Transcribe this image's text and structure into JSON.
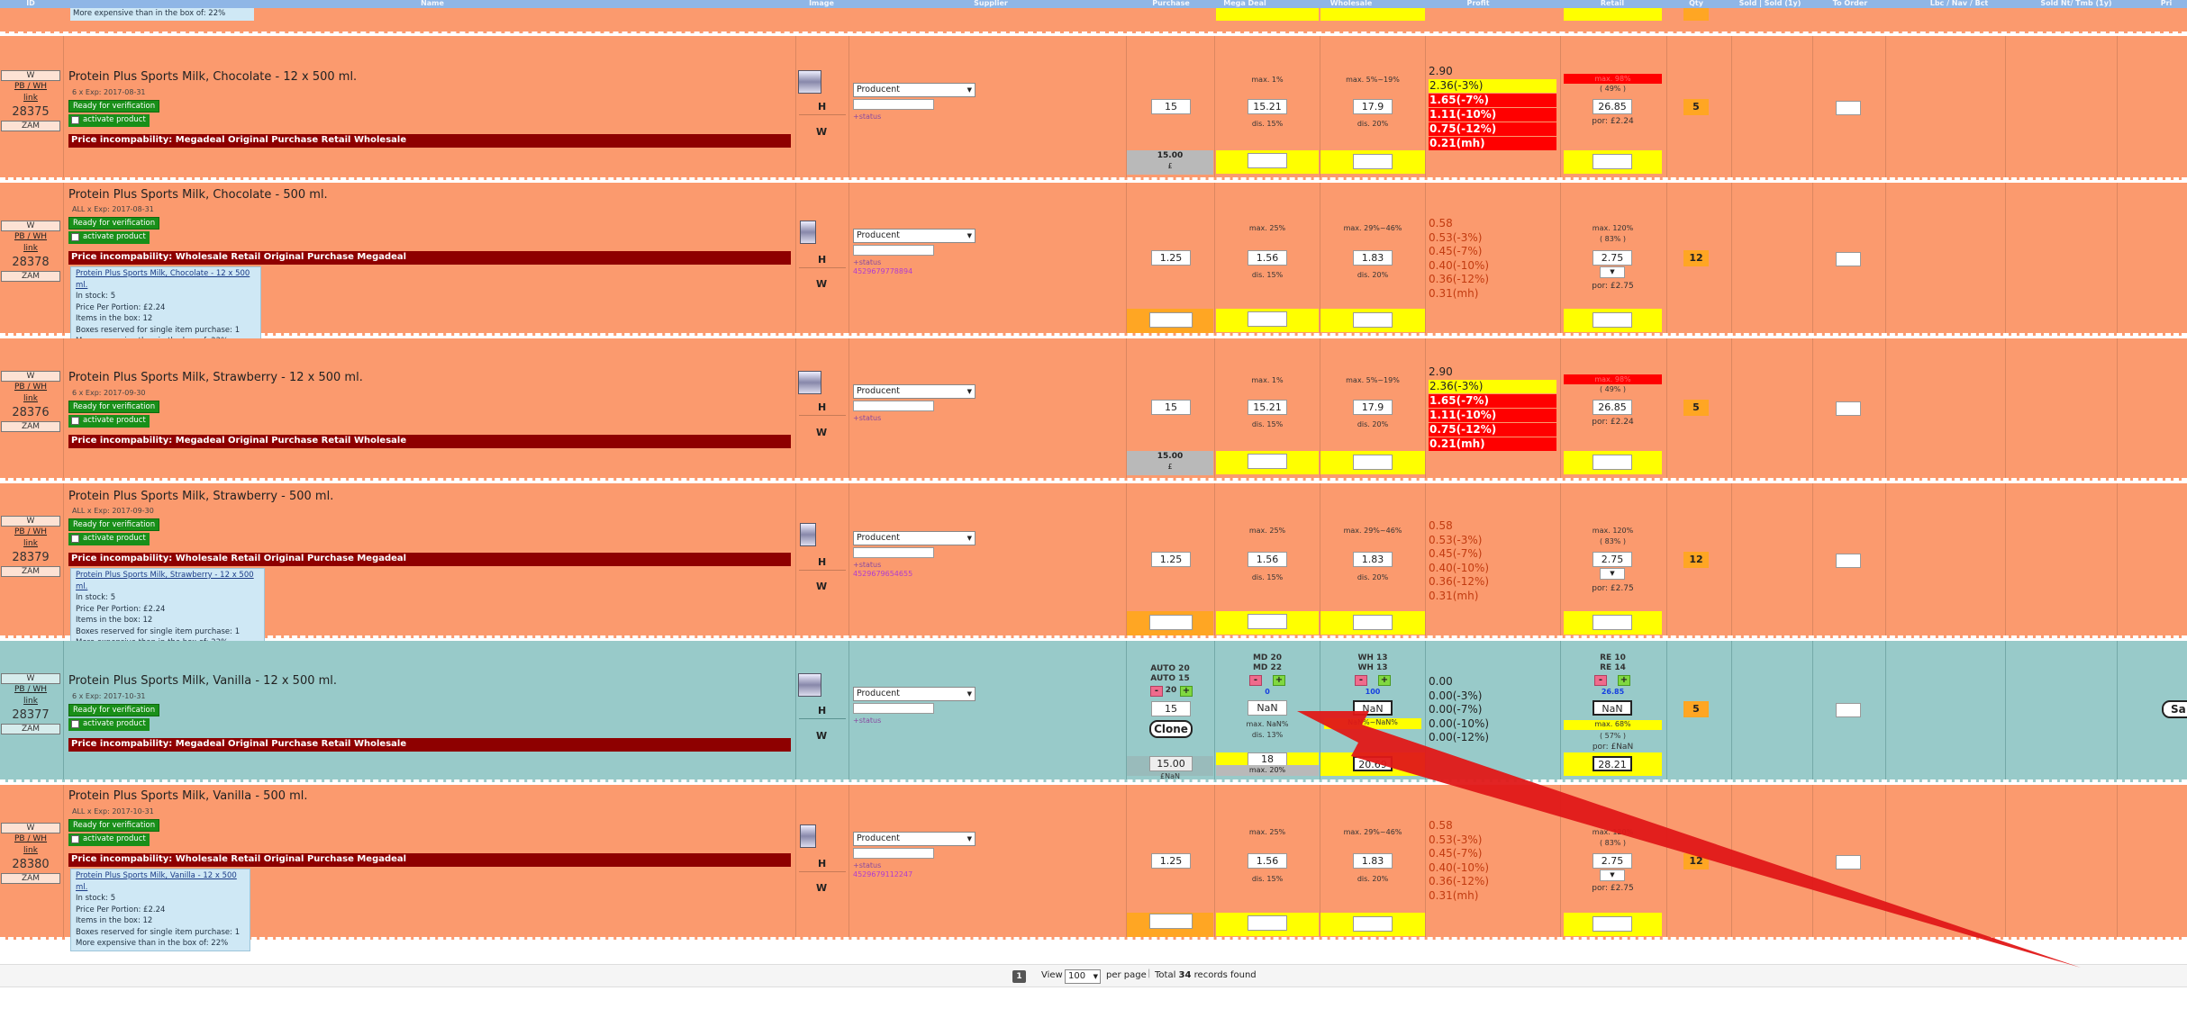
{
  "headers": [
    "ID",
    "Name",
    "Image",
    "Supplier",
    "Purchase",
    "Mega Deal",
    "Wholesale",
    "Profit",
    "Retail",
    "Qty",
    "Sold | Sold (1y)",
    "To Order",
    "Lbc / Nav / Bct",
    "Sold Nt/ Tmb (1y)",
    "Pri"
  ],
  "top_strip_text": "More expensive than in the box of: 22%",
  "common": {
    "w": "W",
    "pb": "PB",
    "wh": "WH",
    "slash": "/",
    "link": "link",
    "zam": "ZAM",
    "h_label": "H",
    "w_label": "W",
    "ready": "Ready for verification",
    "activate": "activate product",
    "supplier": "Producent",
    "status": "+status",
    "in_stock": "In stock: 5",
    "price_portion": "Price Per Portion: £2.24",
    "items_box": "Items in the box: 12",
    "boxes_reserved": "Boxes reserved for single item purchase: 1",
    "more_expensive": "More expensive than in the box of: 22%"
  },
  "rows": [
    {
      "id": "28375",
      "name": "Protein Plus Sports Milk, Chocolate - 12 x 500 ml.",
      "exp": "6 x Exp: 2017-08-31",
      "incompat": "Price incompability: Megadeal Original Purchase Retail Wholesale",
      "purchase": "15",
      "purchase_foot": "15.00",
      "purchase_foot2": "£",
      "mega_top": "max. 1%",
      "mega": "15.21",
      "mega_bottom": "dis. 15%",
      "wh_top": "max. 5%~19%",
      "wholesale": "17.9",
      "wh_bottom": "dis. 20%",
      "profit": [
        "2.90",
        "2.36(-3%)",
        "1.65(-7%)",
        "1.11(-10%)",
        "0.75(-12%)",
        "0.21(mh)"
      ],
      "retail_top": "max. 98%",
      "retail_pct": "( 49% )",
      "retail": "26.85",
      "retail_por": "por: £2.24",
      "qty": "5"
    },
    {
      "id": "28378",
      "name": "Protein Plus Sports Milk, Chocolate - 500 ml.",
      "exp": "ALL x Exp: 2017-08-31",
      "incompat": "Price incompability: Wholesale Retail Original Purchase Megadeal",
      "box_link": "Protein Plus Sports Milk, Chocolate - 12 x 500 ml.",
      "ean": "4529679778894",
      "purchase": "1.25",
      "mega_top": "max. 25%",
      "mega": "1.56",
      "mega_bottom": "dis. 15%",
      "wh_top": "max. 29%~46%",
      "wholesale": "1.83",
      "wh_bottom": "dis. 20%",
      "profit": [
        "0.58",
        "0.53(-3%)",
        "0.45(-7%)",
        "0.40(-10%)",
        "0.36(-12%)",
        "0.31(mh)"
      ],
      "retail_top": "max. 120%",
      "retail_pct": "( 83% )",
      "retail": "2.75",
      "retail_por": "por: £2.75",
      "qty": "12"
    },
    {
      "id": "28376",
      "name": "Protein Plus Sports Milk, Strawberry - 12 x 500 ml.",
      "exp": "6 x Exp: 2017-09-30",
      "incompat": "Price incompability: Megadeal Original Purchase Retail Wholesale",
      "purchase": "15",
      "purchase_foot": "15.00",
      "purchase_foot2": "£",
      "mega_top": "max. 1%",
      "mega": "15.21",
      "mega_bottom": "dis. 15%",
      "wh_top": "max. 5%~19%",
      "wholesale": "17.9",
      "wh_bottom": "dis. 20%",
      "profit": [
        "2.90",
        "2.36(-3%)",
        "1.65(-7%)",
        "1.11(-10%)",
        "0.75(-12%)",
        "0.21(mh)"
      ],
      "retail_top": "max. 98%",
      "retail_pct": "( 49% )",
      "retail": "26.85",
      "retail_por": "por: £2.24",
      "qty": "5"
    },
    {
      "id": "28379",
      "name": "Protein Plus Sports Milk, Strawberry - 500 ml.",
      "exp": "ALL x Exp: 2017-09-30",
      "incompat": "Price incompability: Wholesale Retail Original Purchase Megadeal",
      "box_link": "Protein Plus Sports Milk, Strawberry - 12 x 500 ml.",
      "ean": "4529679654655",
      "purchase": "1.25",
      "mega_top": "max. 25%",
      "mega": "1.56",
      "mega_bottom": "dis. 15%",
      "wh_top": "max. 29%~46%",
      "wholesale": "1.83",
      "wh_bottom": "dis. 20%",
      "profit": [
        "0.58",
        "0.53(-3%)",
        "0.45(-7%)",
        "0.40(-10%)",
        "0.36(-12%)",
        "0.31(mh)"
      ],
      "retail_top": "max. 120%",
      "retail_pct": "( 83% )",
      "retail": "2.75",
      "retail_por": "por: £2.75",
      "qty": "12"
    },
    {
      "id": "28377",
      "name": "Protein Plus Sports Milk, Vanilla - 12 x 500 ml.",
      "exp": "6 x Exp: 2017-10-31",
      "incompat": "Price incompability: Megadeal Original Purchase Retail Wholesale",
      "auto1": "AUTO 20",
      "auto2": "AUTO 15",
      "auto_val": "20",
      "purchase": "15",
      "clone": "Clone",
      "purchase_foot": "15.00",
      "purchase_foot2": "£NaN",
      "md1": "MD 20",
      "md2": "MD 22",
      "md_val": "0",
      "mega": "NaN",
      "mega_max": "max. NaN%",
      "mega_dis": "dis. 13%",
      "mega_foot": "18",
      "mega_foot2": "max. 20%",
      "wh1": "WH 13",
      "wh2": "WH 13",
      "wh_val": "100",
      "wholesale": "NaN",
      "wh_mid": "NaN%~NaN%",
      "wh_foot": "20.69",
      "profit": [
        "0.00",
        "0.00(-3%)",
        "0.00(-7%)",
        "0.00(-10%)",
        "0.00(-12%)"
      ],
      "re1": "RE 10",
      "re2": "RE 14",
      "re_val": "26.85",
      "retail": "NaN",
      "retail_max": "max. 68%",
      "retail_pct": "( 57% )",
      "retail_por": "por: £NaN",
      "retail_foot": "28.21",
      "qty": "5",
      "save": "Sa"
    },
    {
      "id": "28380",
      "name": "Protein Plus Sports Milk, Vanilla - 500 ml.",
      "exp": "ALL x Exp: 2017-10-31",
      "incompat": "Price incompability: Wholesale Retail Original Purchase Megadeal",
      "box_link": "Protein Plus Sports Milk, Vanilla - 12 x 500 ml.",
      "ean": "4529679112247",
      "purchase": "1.25",
      "mega_top": "max. 25%",
      "mega": "1.56",
      "mega_bottom": "dis. 15%",
      "wh_top": "max. 29%~46%",
      "wholesale": "1.83",
      "wh_bottom": "dis. 20%",
      "profit": [
        "0.58",
        "0.53(-3%)",
        "0.45(-7%)",
        "0.40(-10%)",
        "0.36(-12%)",
        "0.31(mh)"
      ],
      "retail_top": "max. 120%",
      "retail_pct": "( 83% )",
      "retail": "2.75",
      "retail_por": "por: £2.75",
      "qty": "12"
    }
  ],
  "footer": {
    "page": "1",
    "view": "View",
    "per_page_value": "100",
    "per_page_label": "per page",
    "total_prefix": "Total",
    "total_count": "34",
    "total_suffix": "records found"
  },
  "colors": {
    "row_orange": "#fb9a6e",
    "row_teal": "#98cac9",
    "incompat_red": "#8e0000",
    "ready_green": "#198f19",
    "highlight_yellow": "#ffff00",
    "arrow_red": "#e01818"
  }
}
